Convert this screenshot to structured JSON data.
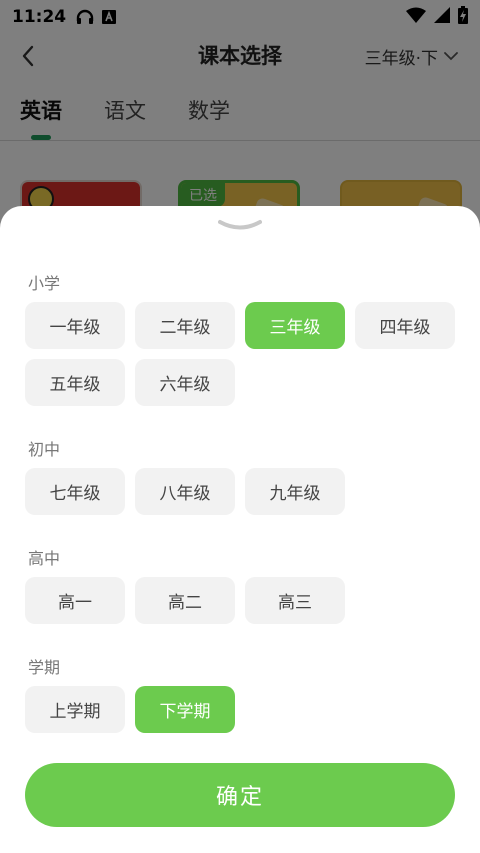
{
  "status_bar": {
    "time": "11:24",
    "left_icons": [
      "headset-icon",
      "font-a-icon"
    ],
    "right_icons": [
      "wifi-icon",
      "cellular-signal-icon",
      "battery-charging-icon"
    ]
  },
  "header": {
    "title": "课本选择",
    "grade_selector": "三年级·下"
  },
  "subject_tabs": [
    {
      "label": "英语",
      "active": true
    },
    {
      "label": "语文",
      "active": false
    },
    {
      "label": "数学",
      "active": false
    }
  ],
  "books": {
    "selected_badge": "已选"
  },
  "sheet": {
    "sections": [
      {
        "title": "小学",
        "options": [
          "一年级",
          "二年级",
          "三年级",
          "四年级",
          "五年级",
          "六年级"
        ],
        "selected": "三年级"
      },
      {
        "title": "初中",
        "options": [
          "七年级",
          "八年级",
          "九年级"
        ],
        "selected": null
      },
      {
        "title": "高中",
        "options": [
          "高一",
          "高二",
          "高三"
        ],
        "selected": null
      },
      {
        "title": "学期",
        "options": [
          "上学期",
          "下学期"
        ],
        "selected": "下学期"
      }
    ],
    "confirm_label": "确定"
  },
  "colors": {
    "accent": "#6ccb4e",
    "tab_indicator": "#1e9a5a",
    "pill_bg": "#f2f2f2"
  }
}
